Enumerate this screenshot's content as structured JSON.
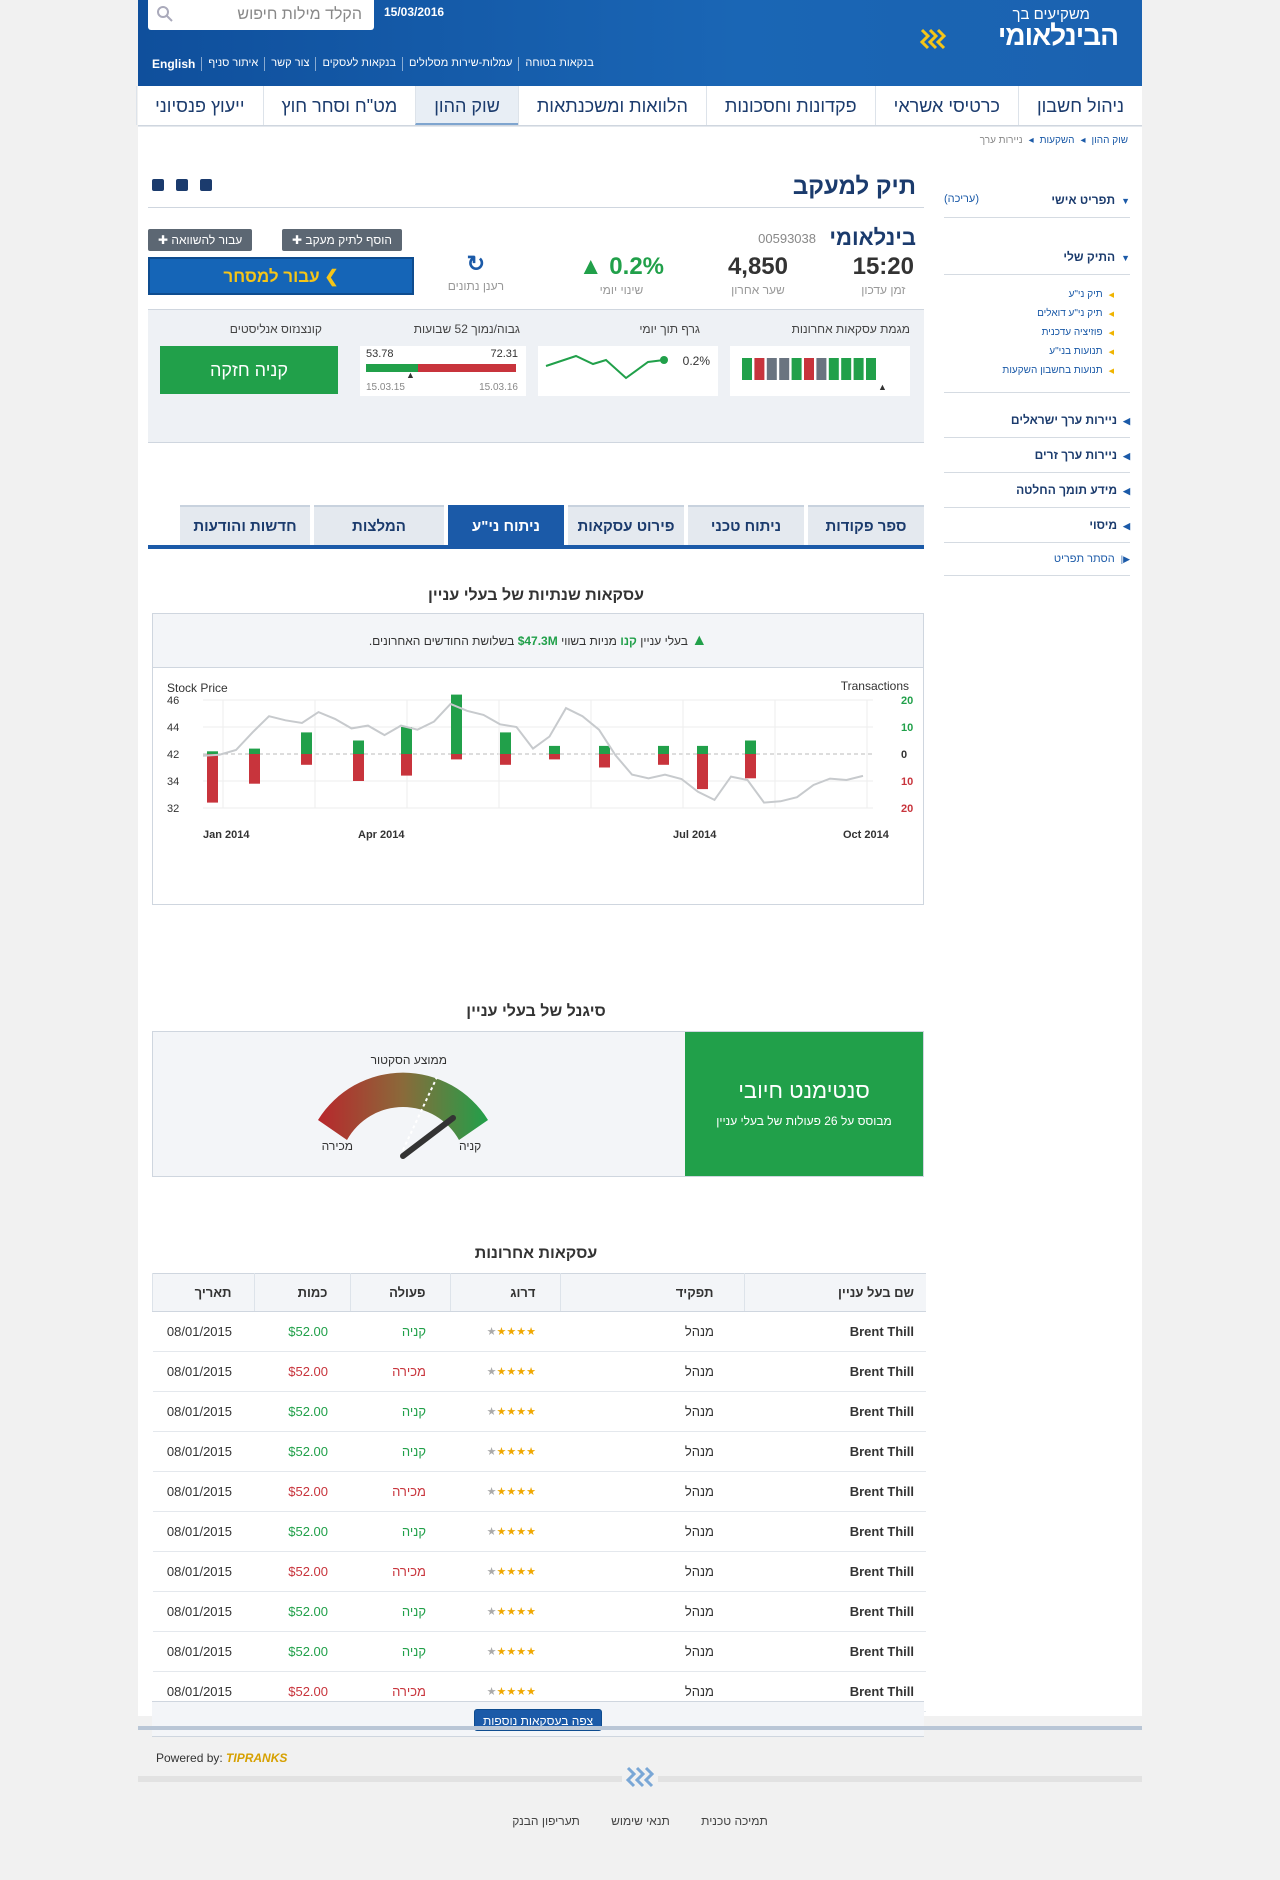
{
  "header": {
    "search_placeholder": "הקלד מילות חיפוש",
    "date": "15/03/2016",
    "logo_sub": "משקיעים בך",
    "logo_main": "הבינלאומי",
    "links": [
      "English",
      "איתור סניף",
      "צור קשר",
      "בנקאות לעסקים",
      "עמלות-שירות מסלולים",
      "בנקאות בטוחה"
    ]
  },
  "nav": [
    "ניהול חשבון",
    "כרטיסי אשראי",
    "פקדונות וחסכונות",
    "הלוואות ומשכנתאות",
    "שוק ההון",
    "מט\"ח וסחר חוץ",
    "ייעוץ פנסיוני"
  ],
  "breadcrumb": [
    "שוק ההון",
    "השקעות",
    "ניירות ערך"
  ],
  "sidebar": {
    "personal": "תפריט אישי",
    "edit": "(עריכה)",
    "my_portfolio": "התיק שלי",
    "portfolio_items": [
      "תיק ני\"ע",
      "תיק ני\"ע דואלים",
      "פוזיציה עדכנית",
      "תנועות בני\"ע",
      "תנועות בחשבון השקעות"
    ],
    "sections": [
      "ניירות ערך ישראלים",
      "ניירות ערך זרים",
      "מידע תומך החלטה",
      "מיסוי"
    ],
    "hide_menu": "הסתר תפריט"
  },
  "page": {
    "title": "תיק למעקב",
    "stock_name": "בינלאומי",
    "stock_id": "00593038",
    "time_value": "15:20",
    "time_label": "זמן עדכון",
    "last_value": "4,850",
    "last_label": "שער אחרון",
    "change_value": "0.2%",
    "change_label": "שינוי יומי",
    "refresh_label": "רענן נתונים",
    "add_watch": "הוסף לתיק מעקב",
    "compare": "עבור להשוואה",
    "trade": "עבור למסחר"
  },
  "panel": {
    "recent_trades": "מגמת עסקאות אחרונות",
    "intraday": "גרף תוך יומי",
    "intraday_change": "0.2%",
    "range52": "גבוה/נמוך 52 שבועות",
    "range_low": "53.78",
    "range_high": "72.31",
    "range_low_date": "15.03.15",
    "range_high_date": "15.03.16",
    "consensus": "קונצנזוס אנליסטים",
    "consensus_value": "קניה חזקה"
  },
  "tabs": [
    "ספר פקודות",
    "ניתוח טכני",
    "פירוט עסקאות",
    "ניתוח ני\"ע",
    "המלצות",
    "חדשות והודעות"
  ],
  "insider": {
    "title": "עסקאות שנתיות של בעלי עניין",
    "sentence_pre": "בעלי עניין",
    "sentence_bought": "קנו",
    "sentence_mid": "מניות בשווי",
    "sentence_amount": "$47.3M",
    "sentence_post": "בשלושת החודשים האחרונים."
  },
  "chart_data": {
    "type": "bar",
    "left_axis_label": "Stock Price",
    "right_axis_label": "Transactions",
    "price_ticks": [
      "46",
      "44",
      "42",
      "34",
      "32"
    ],
    "tx_ticks": [
      "20",
      "10",
      "0",
      "10",
      "20"
    ],
    "x_labels": [
      "Jan 2014",
      "Apr 2014",
      "Jul 2014",
      "Oct 2014"
    ],
    "buys": [
      1,
      2,
      8,
      5,
      10,
      22,
      8,
      3,
      3,
      3,
      3,
      5
    ],
    "sells": [
      -18,
      -11,
      -4,
      -10,
      -8,
      -2,
      -4,
      -2,
      -5,
      -4,
      -13,
      -9
    ],
    "price_line": [
      41.5,
      41.8,
      42.3,
      43.6,
      44.8,
      44.5,
      44.3,
      45.1,
      44.6,
      43.9,
      44.1,
      43.4,
      44.1,
      43.8,
      44.4,
      45.7,
      45.2,
      44.9,
      44.2,
      44.0,
      42.4,
      43.3,
      45.4,
      44.8,
      43.8,
      41.6,
      35.9,
      34.8,
      35.9,
      34.6,
      33.2,
      32.6,
      35.3,
      34.3,
      32.4,
      32.5,
      32.8,
      33.7,
      34.7,
      34.3,
      35.5
    ]
  },
  "signal": {
    "title": "סיגנל של בעלי עניין",
    "sector_avg": "ממוצע הסקטור",
    "sell": "מכירה",
    "buy": "קניה",
    "sentiment": "סנטימנט חיובי",
    "based_on": "מבוסס על 26 פעולות של בעלי עניין",
    "gauge_level": 0.82
  },
  "trades": {
    "title": "עסקאות אחרונות",
    "headers": [
      "שם בעל עניין",
      "תפקיד",
      "דרוג",
      "פעולה",
      "כמות",
      "תאריך"
    ],
    "rows": [
      {
        "name": "Brent Thill",
        "role": "מנהל",
        "rating": 4,
        "action": "קניה",
        "type": "buy",
        "amount": "$52.00",
        "date": "08/01/2015"
      },
      {
        "name": "Brent Thill",
        "role": "מנהל",
        "rating": 4,
        "action": "מכירה",
        "type": "sell",
        "amount": "$52.00",
        "date": "08/01/2015"
      },
      {
        "name": "Brent Thill",
        "role": "מנהל",
        "rating": 4,
        "action": "קניה",
        "type": "buy",
        "amount": "$52.00",
        "date": "08/01/2015"
      },
      {
        "name": "Brent Thill",
        "role": "מנהל",
        "rating": 4,
        "action": "קניה",
        "type": "buy",
        "amount": "$52.00",
        "date": "08/01/2015"
      },
      {
        "name": "Brent Thill",
        "role": "מנהל",
        "rating": 4,
        "action": "מכירה",
        "type": "sell",
        "amount": "$52.00",
        "date": "08/01/2015"
      },
      {
        "name": "Brent Thill",
        "role": "מנהל",
        "rating": 4,
        "action": "קניה",
        "type": "buy",
        "amount": "$52.00",
        "date": "08/01/2015"
      },
      {
        "name": "Brent Thill",
        "role": "מנהל",
        "rating": 4,
        "action": "מכירה",
        "type": "sell",
        "amount": "$52.00",
        "date": "08/01/2015"
      },
      {
        "name": "Brent Thill",
        "role": "מנהל",
        "rating": 4,
        "action": "קניה",
        "type": "buy",
        "amount": "$52.00",
        "date": "08/01/2015"
      },
      {
        "name": "Brent Thill",
        "role": "מנהל",
        "rating": 4,
        "action": "קניה",
        "type": "buy",
        "amount": "$52.00",
        "date": "08/01/2015"
      },
      {
        "name": "Brent Thill",
        "role": "מנהל",
        "rating": 4,
        "action": "מכירה",
        "type": "sell",
        "amount": "$52.00",
        "date": "08/01/2015"
      }
    ],
    "more": "צפה בעסקאות נוספות"
  },
  "powered_by": "Powered by:",
  "powered_brand": "TIPRANKS",
  "footer": [
    "תמיכה טכנית",
    "תנאי שימוש",
    "תעריפון הבנק"
  ],
  "colors": {
    "buy": "#21a04a",
    "sell": "#c8343c",
    "brand": "#1b5aa8"
  },
  "recent_trend": [
    "green",
    "red",
    "gray",
    "gray",
    "green",
    "red",
    "gray",
    "green",
    "green",
    "green",
    "green"
  ]
}
